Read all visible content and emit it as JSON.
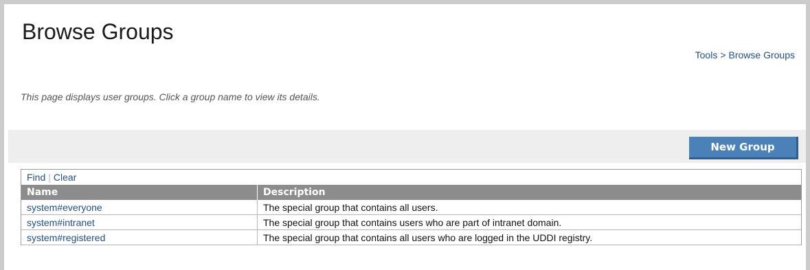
{
  "page": {
    "title": "Browse Groups",
    "description": "This page displays user groups. Click a group name to view its details."
  },
  "breadcrumb": {
    "items": [
      "Tools",
      "Browse Groups"
    ],
    "separator": ">"
  },
  "toolbar": {
    "new_group_label": "New Group"
  },
  "filter": {
    "find_label": "Find",
    "separator": "|",
    "clear_label": "Clear"
  },
  "table": {
    "columns": [
      "Name",
      "Description"
    ],
    "rows": [
      {
        "name": "system#everyone",
        "description": "The special group that contains all users."
      },
      {
        "name": "system#intranet",
        "description": "The special group that contains users who are part of intranet domain."
      },
      {
        "name": "system#registered",
        "description": "The special group that contains all users who are logged in the UDDI registry."
      }
    ]
  },
  "colors": {
    "accent_button": "#4a81b8",
    "link": "#1f4e8c",
    "header_bg": "#8c8c8c",
    "toolbar_bg": "#eeeeee"
  }
}
